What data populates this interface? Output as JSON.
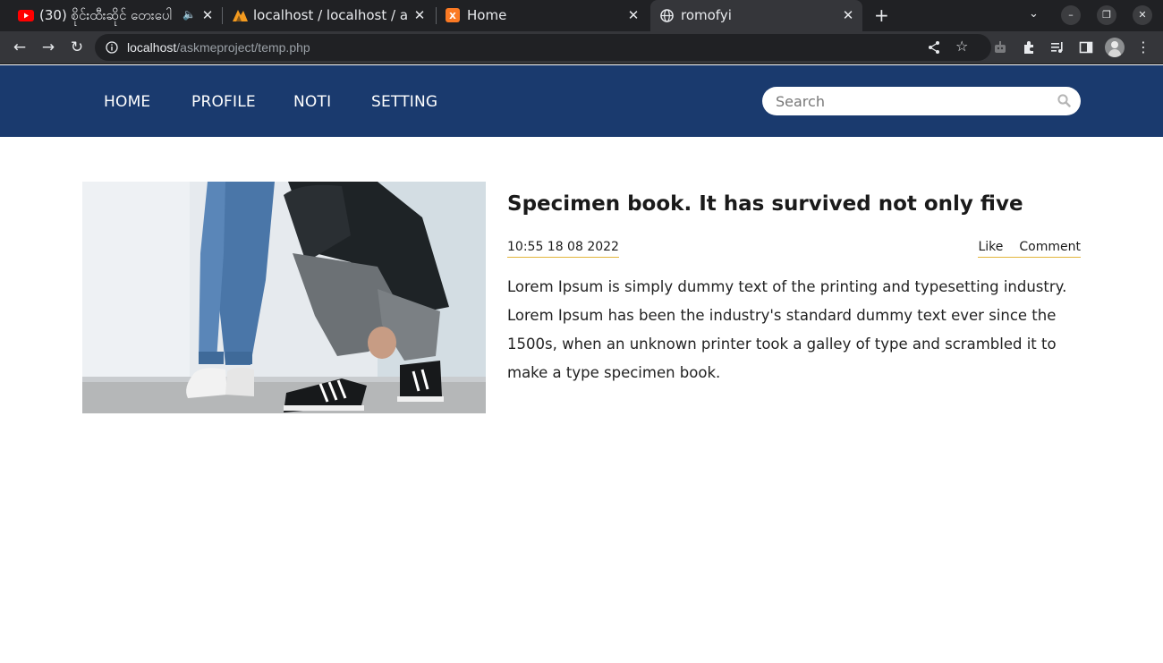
{
  "browser": {
    "tabs": [
      {
        "title": "(30) စိုင်းထီးဆိုင် တေးပေါ",
        "favicon": "youtube-icon",
        "audio": true
      },
      {
        "title": "localhost / localhost / ask",
        "favicon": "phpmyadmin-icon"
      },
      {
        "title": "Home",
        "favicon": "xampp-icon"
      },
      {
        "title": "romofyi",
        "favicon": "globe-icon",
        "active": true
      }
    ],
    "url_host": "localhost",
    "url_path": "/askmeproject/temp.php"
  },
  "nav": {
    "links": [
      "HOME",
      "PROFILE",
      "NOTI",
      "SETTING"
    ],
    "search_placeholder": "Search",
    "bg_color": "#1a3a6e"
  },
  "post": {
    "title": "Specimen book. It has survived not only five",
    "date": "10:55 18 08 2022",
    "like_label": "Like",
    "comment_label": "Comment",
    "body": "Lorem Ipsum is simply dummy text of the printing and typesetting industry. Lorem Ipsum has been the industry's standard dummy text ever since the 1500s, when an unknown printer took a galley of type and scrambled it to make a type specimen book.",
    "accent_color": "#e2b53b"
  }
}
